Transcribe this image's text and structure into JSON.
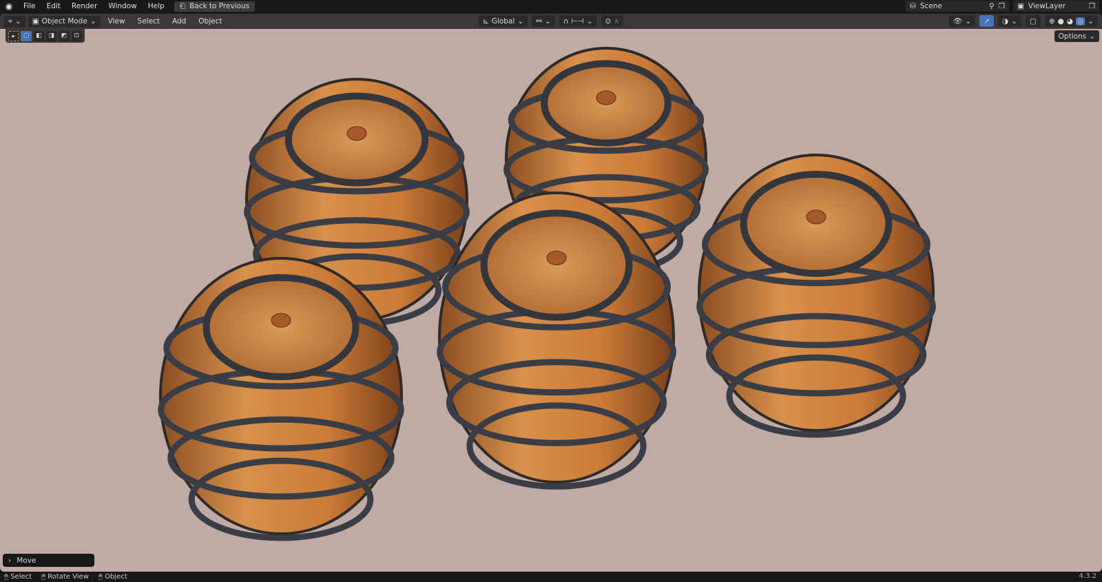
{
  "topbar": {
    "menus": [
      "File",
      "Edit",
      "Render",
      "Window",
      "Help"
    ],
    "back_label": "Back to Previous",
    "scene": "Scene",
    "view_layer": "ViewLayer"
  },
  "header": {
    "mode": "Object Mode",
    "menus": [
      "View",
      "Select",
      "Add",
      "Object"
    ],
    "orientation": "Global",
    "options": "Options"
  },
  "operator_panel": {
    "label": "Move"
  },
  "statusbar": {
    "items": [
      "Select",
      "Rotate View",
      "Object"
    ],
    "version": "4.3.2"
  },
  "colors": {
    "viewport": "#bfaba4",
    "accent": "#4772b3",
    "wood": "#c9803f",
    "iron": "#3a3d45"
  }
}
